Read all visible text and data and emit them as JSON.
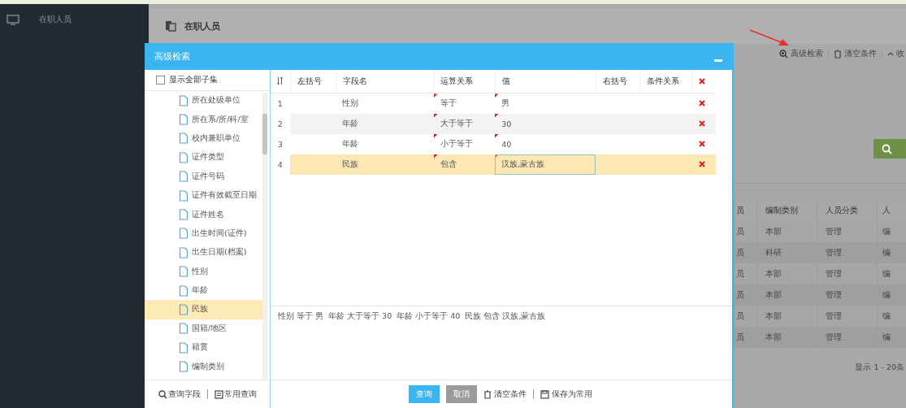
{
  "sidebar": {
    "items": [
      {
        "label": "在职人员",
        "selected": true
      }
    ]
  },
  "page": {
    "title": "在职人员",
    "toolbar": [
      "高级检索",
      "清空条件",
      "收"
    ],
    "table": {
      "columns": [
        "员",
        "编制类别",
        "人员分类",
        "人"
      ],
      "rows": [
        [
          "员",
          "本部",
          "管理",
          "编"
        ],
        [
          "员",
          "科研",
          "管理",
          "编"
        ],
        [
          "员",
          "本部",
          "管理",
          "编"
        ],
        [
          "员",
          "本部",
          "管理",
          "编"
        ],
        [
          "员",
          "本部",
          "管理",
          "编"
        ],
        [
          "员",
          "本部",
          "管理",
          "编"
        ]
      ]
    },
    "footer": "显示 1 - 20条"
  },
  "dialog": {
    "title": "高级检索",
    "show_all": {
      "label": "显示全部子集",
      "checked": false
    },
    "fields": [
      {
        "label": "所在处级单位",
        "selected": false
      },
      {
        "label": "所在系/所/科/室",
        "selected": false
      },
      {
        "label": "校内兼职单位",
        "selected": false
      },
      {
        "label": "证件类型",
        "selected": false
      },
      {
        "label": "证件号码",
        "selected": false
      },
      {
        "label": "证件有效截至日期",
        "selected": false
      },
      {
        "label": "证件姓名",
        "selected": false
      },
      {
        "label": "出生时间(证件)",
        "selected": false
      },
      {
        "label": "出生日期(档案)",
        "selected": false
      },
      {
        "label": "性别",
        "selected": false
      },
      {
        "label": "年龄",
        "selected": false
      },
      {
        "label": "民族",
        "selected": true
      },
      {
        "label": "国籍/地区",
        "selected": false
      },
      {
        "label": "籍贯",
        "selected": false
      },
      {
        "label": "编制类别",
        "selected": false
      }
    ],
    "left_footer": [
      "查询字段",
      "常用查询"
    ],
    "columns": [
      "左括号",
      "字段名",
      "运算关系",
      "值",
      "右括号",
      "条件关系"
    ],
    "rows": [
      {
        "num": "1",
        "field": "性别",
        "op": "等于",
        "value": "男",
        "selected": false
      },
      {
        "num": "2",
        "field": "年龄",
        "op": "大于等于",
        "value": "30",
        "selected": false
      },
      {
        "num": "3",
        "field": "年龄",
        "op": "小于等于",
        "value": "40",
        "selected": false
      },
      {
        "num": "4",
        "field": "民族",
        "op": "包含",
        "value": "汉族,蒙古族",
        "selected": true
      }
    ],
    "summary": "性别 等于 男  年龄 大于等于 30  年龄 小于等于 40  民族 包含 汉族,蒙古族",
    "buttons": [
      {
        "label": "查询",
        "kind": "primary"
      },
      {
        "label": "取消",
        "kind": "secondary"
      },
      {
        "label": "清空条件",
        "kind": "clear"
      },
      {
        "label": "保存为常用",
        "kind": "save"
      }
    ]
  }
}
